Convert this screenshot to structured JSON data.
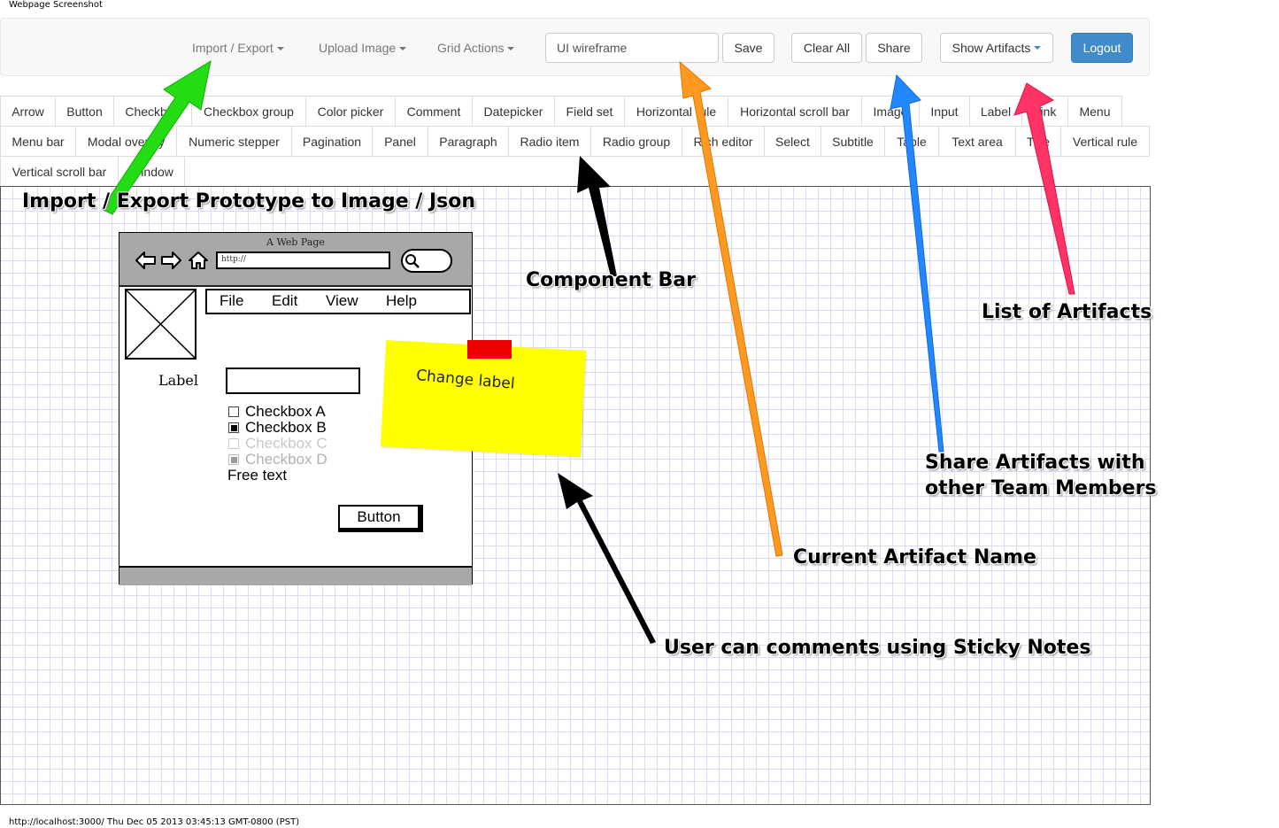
{
  "page": {
    "header_title": "Webpage Screenshot",
    "footer_text": "http://localhost:3000/ Thu Dec 05 2013 03:45:13 GMT-0800 (PST)"
  },
  "navbar": {
    "import_export": "Import / Export",
    "upload_image": "Upload Image",
    "grid_actions": "Grid Actions",
    "artifact_name_value": "UI wireframe",
    "save": "Save",
    "clear_all": "Clear All",
    "share": "Share",
    "show_artifacts": "Show Artifacts",
    "logout": "Logout",
    "accent_color": "#428bca"
  },
  "components": {
    "row1": [
      "Arrow",
      "Button",
      "Checkbox",
      "Checkbox group",
      "Color picker",
      "Comment",
      "Datepicker",
      "Field set",
      "Horizontal rule",
      "Horizontal scroll bar",
      "Image",
      "Input",
      "Label",
      "Link",
      "Menu"
    ],
    "row2": [
      "Menu bar",
      "Modal overlay",
      "Numeric stepper",
      "Pagination",
      "Panel",
      "Paragraph",
      "Radio item",
      "Radio group",
      "Rich editor",
      "Select",
      "Subtitle",
      "Table",
      "Text area",
      "Title",
      "Vertical rule"
    ],
    "row3": [
      "Vertical scroll bar",
      "Window"
    ]
  },
  "mockup": {
    "window_title": "A Web Page",
    "url_text": "http://",
    "menu": [
      "File",
      "Edit",
      "View",
      "Help"
    ],
    "label": "Label",
    "checkboxes": [
      {
        "label": "Checkbox A",
        "state": "unchecked"
      },
      {
        "label": "Checkbox B",
        "state": "checked"
      },
      {
        "label": "Checkbox C",
        "state": "disabled"
      },
      {
        "label": "Checkbox D",
        "state": "disabled-checked"
      }
    ],
    "free_text": "Free text",
    "button": "Button"
  },
  "sticky_note": {
    "text": "Change label",
    "color": "#ffff00",
    "tape_color": "#ee0000"
  },
  "annotations": {
    "import_export": "Import / Export Prototype to Image / Json",
    "component_bar": "Component Bar",
    "list_of_artifacts": "List of Artifacts",
    "share_line1": "Share Artifacts with",
    "share_line2": "other Team Members",
    "current_artifact": "Current Artifact Name",
    "sticky_notes": "User can comments using Sticky Notes",
    "arrow_colors": {
      "green": "#22dd11",
      "orange": "#ff9922",
      "blue": "#2288ff",
      "pink": "#ff3366",
      "black": "#000000"
    }
  }
}
